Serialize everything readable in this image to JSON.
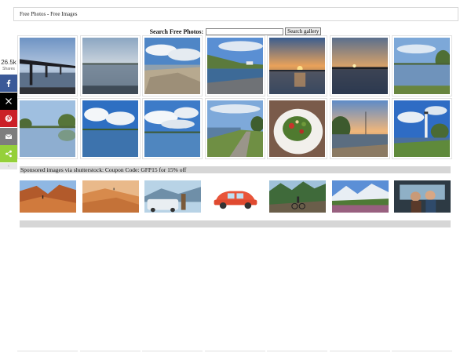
{
  "breadcrumb": "Free Photos - Free Images",
  "search": {
    "label": "Search Free Photos:",
    "value": "",
    "button": "Search gallery"
  },
  "share": {
    "count": "26.5k",
    "count_label": "Shares",
    "buttons": [
      {
        "name": "facebook",
        "color": "#3b5998"
      },
      {
        "name": "twitter-x",
        "color": "#000000"
      },
      {
        "name": "pinterest",
        "color": "#cb2027"
      },
      {
        "name": "email",
        "color": "#7d7d7d"
      },
      {
        "name": "share",
        "color": "#95d03a"
      }
    ],
    "collapse_glyph": "‹"
  },
  "gallery": {
    "photos": [
      {
        "subject": "bridge-over-river"
      },
      {
        "subject": "calm-lake-horizon"
      },
      {
        "subject": "rocky-beach-clouds"
      },
      {
        "subject": "lakeshore-boats"
      },
      {
        "subject": "sunset-water"
      },
      {
        "subject": "sunset-lake"
      },
      {
        "subject": "lake-reflection-trees"
      },
      {
        "subject": "lake-trees-reflection"
      },
      {
        "subject": "blue-sky-clouds-lake"
      },
      {
        "subject": "clouds-over-water"
      },
      {
        "subject": "lakeside-path"
      },
      {
        "subject": "salad-plate"
      },
      {
        "subject": "sunset-sailboat-pier"
      },
      {
        "subject": "lighthouse-shore"
      }
    ]
  },
  "sponsored": {
    "label": "Sponsored images via shutterstock: Coupon Code: GFP15 for 15% off",
    "images": [
      {
        "subject": "canyon-hikers"
      },
      {
        "subject": "desert-dunes"
      },
      {
        "subject": "car-travel-couple"
      },
      {
        "subject": "red-car-cartoon"
      },
      {
        "subject": "mountain-biker"
      },
      {
        "subject": "mountain-wildflowers"
      },
      {
        "subject": "couple-in-car"
      }
    ]
  }
}
